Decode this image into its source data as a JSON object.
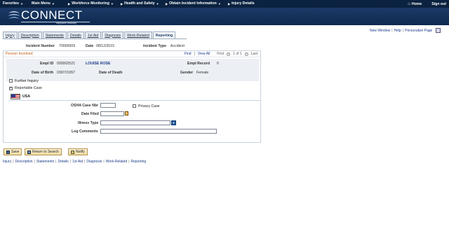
{
  "topnav": {
    "items": [
      {
        "label": "Favorites"
      },
      {
        "label": "Main Menu"
      },
      {
        "label": "Workforce Monitoring"
      },
      {
        "label": "Health and Safety"
      },
      {
        "label": "Obtain Incident Information"
      },
      {
        "label": "Injury Details"
      }
    ],
    "home": "Home",
    "signout": "Sign out"
  },
  "brand": {
    "name": "CONNECT",
    "tagline": "Maryland Judiciary"
  },
  "rightlinks": {
    "new_window": "New Window",
    "help": "Help",
    "personalize": "Personalize Page"
  },
  "tabs": [
    {
      "label": "Injury",
      "active": false
    },
    {
      "label": "Description",
      "active": false
    },
    {
      "label": "Statements",
      "active": false
    },
    {
      "label": "Details",
      "active": false
    },
    {
      "label": "1st Aid",
      "active": false
    },
    {
      "label": "Diagnosis",
      "active": false
    },
    {
      "label": "Work-Related",
      "active": false
    },
    {
      "label": "Reporting",
      "active": true
    }
  ],
  "header": {
    "incident_number_label": "Incident Number",
    "incident_number": "70000009",
    "date_label": "Date",
    "date": "08/12/2015",
    "incident_type_label": "Incident Type",
    "incident_type": "Accident"
  },
  "person": {
    "title": "Person Involved",
    "nav_find": "Find",
    "nav_view_all": "View All",
    "nav_first": "First",
    "nav_count": "1 of 1",
    "nav_last": "Last",
    "emplid_label": "Empl ID",
    "emplid": "000002521",
    "name": "LOUISE ROSE",
    "empl_record_label": "Empl Record",
    "empl_record": "0",
    "dob_label": "Date of Birth",
    "dob": "03/07/1957",
    "dod_label": "Date of Death",
    "dod": "",
    "gender_label": "Gender",
    "gender": "Female",
    "further_inquiry_label": "Further Inquiry",
    "further_inquiry_checked": false,
    "reportable_case_label": "Reportable Case",
    "reportable_case_checked": true,
    "country": "USA"
  },
  "osha": {
    "case_nbr_label": "OSHA Case Nbr",
    "case_nbr": "",
    "privacy_case_label": "Privacy Case",
    "privacy_case_checked": false,
    "date_filed_label": "Date Filed",
    "date_filed": "",
    "illness_type_label": "Illness Type",
    "illness_type": "",
    "log_comments_label": "Log Comments",
    "log_comments": ""
  },
  "buttons": {
    "save": "Save",
    "return_to_search": "Return to Search",
    "notify": "Notify"
  },
  "footer_links": [
    "Injury",
    "Description",
    "Statements",
    "Details",
    "1st Aid",
    "Diagnosis",
    "Work-Related",
    "Reporting"
  ],
  "colors": {
    "nav_bg": "#0b2240",
    "banner_bg": "#1b3a66",
    "section_title": "#c05b10",
    "link": "#1a3a8a"
  }
}
